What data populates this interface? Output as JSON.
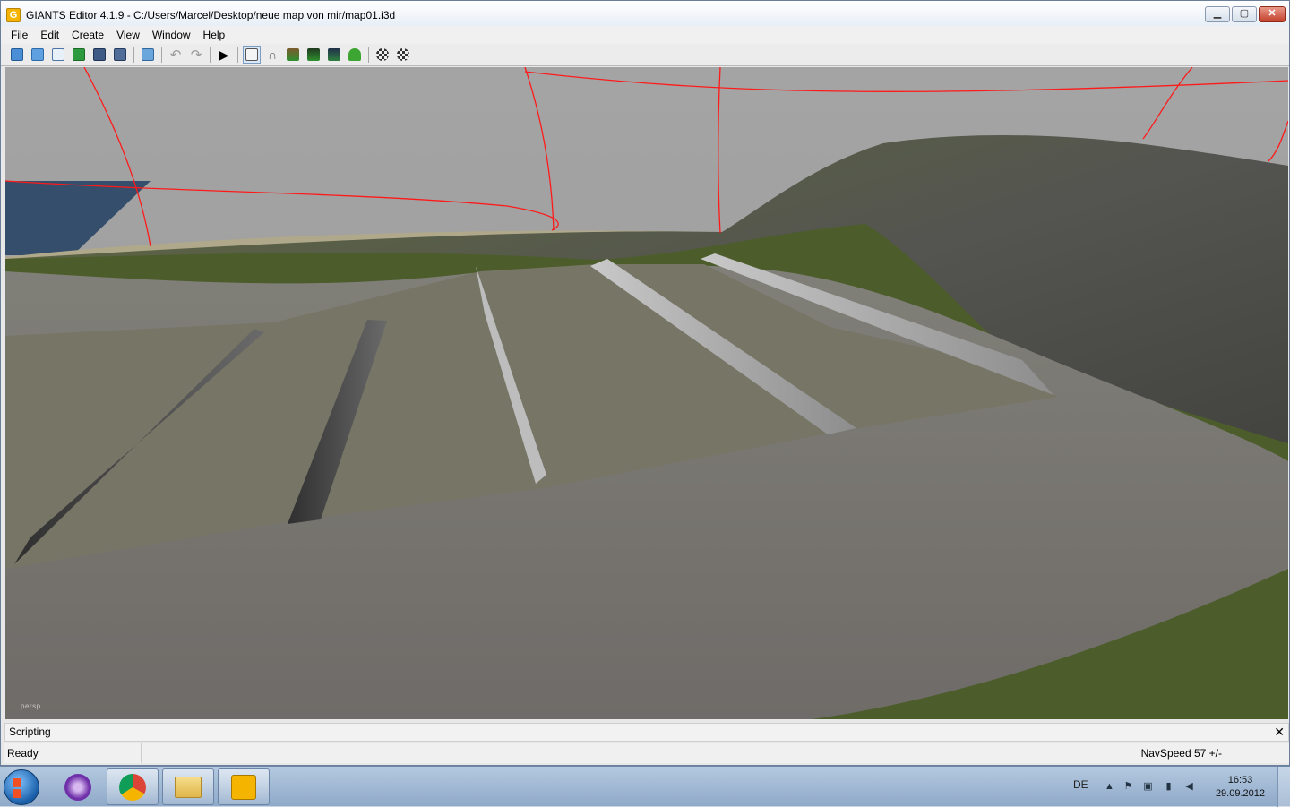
{
  "window": {
    "title": "GIANTS Editor 4.1.9 - C:/Users/Marcel/Desktop/neue map von mir/map01.i3d",
    "app_icon_letter": "G",
    "controls": [
      "minimize",
      "maximize",
      "close"
    ]
  },
  "menu": [
    "File",
    "Edit",
    "Create",
    "View",
    "Window",
    "Help"
  ],
  "toolbar": {
    "icons": [
      "new-icon",
      "open-icon",
      "list-icon",
      "refresh-icon",
      "save-icon",
      "save-all-icon",
      "import-icon",
      "undo-icon",
      "redo-icon",
      "play-icon",
      "select-icon",
      "magnet-icon",
      "terrain-icon",
      "terrain-paint-icon",
      "terrain-detail-icon",
      "foliage-icon",
      "checker-icon",
      "checker-edit-icon"
    ]
  },
  "viewport": {
    "camera_label": "persp"
  },
  "scripting_panel": {
    "label": "Scripting",
    "close_glyph": "✕"
  },
  "status": {
    "left": "Ready",
    "right": "NavSpeed 57 +/-"
  },
  "taskbar": {
    "tray": {
      "language": "DE",
      "time": "16:53",
      "date": "29.09.2012"
    }
  }
}
